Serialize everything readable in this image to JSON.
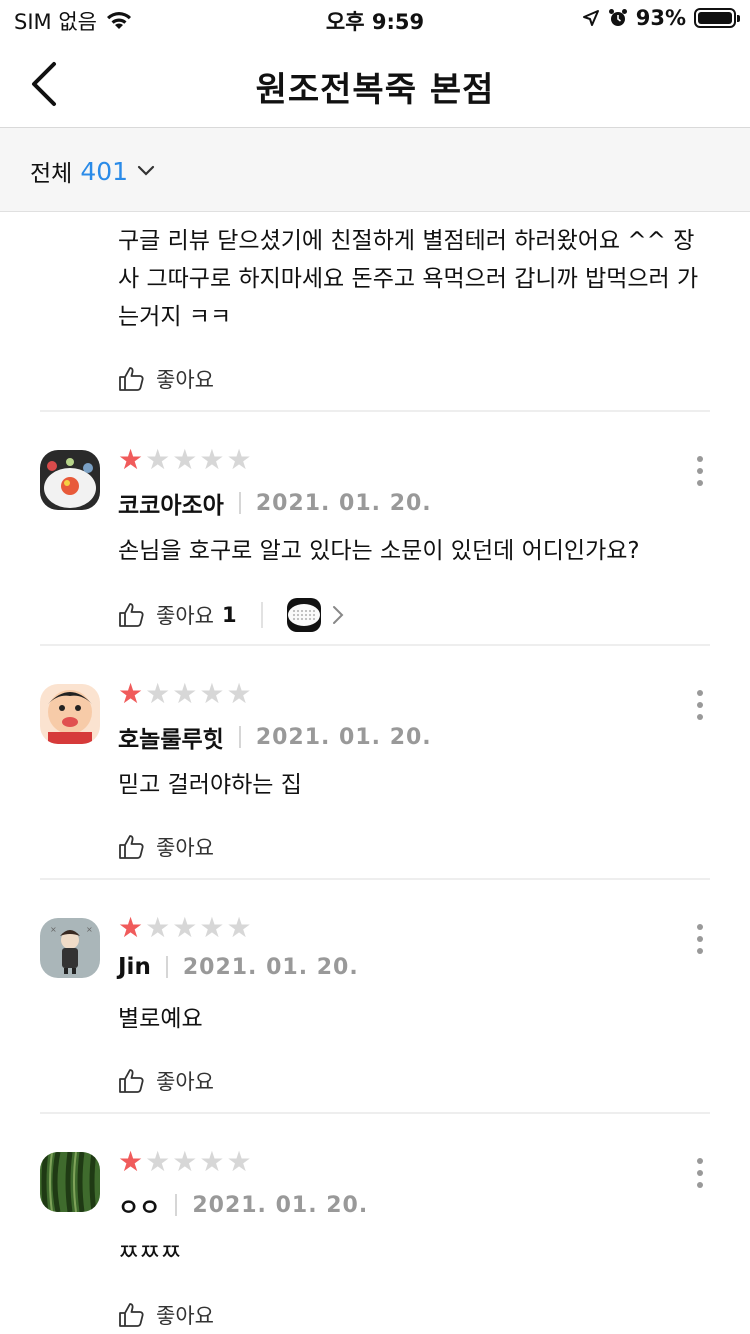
{
  "status": {
    "carrier": "SIM 없음",
    "time": "오후 9:59",
    "battery": "93%"
  },
  "header": {
    "title": "원조전복죽 본점"
  },
  "filter": {
    "label": "전체",
    "count": "401"
  },
  "partial_review": {
    "text": "구글 리뷰 닫으셨기에 친절하게 별점테러 하러왔어요 ^^ 장사 그따구로 하지마세요 돈주고 욕먹으러 갑니까 밥먹으러 가는거지 ㅋㅋ",
    "like_label": "좋아요"
  },
  "reviews": [
    {
      "name": "코코아조아",
      "date": "2021. 01. 20.",
      "rating": 1,
      "text": "손님을 호구로 알고 있다는 소문이 있던데 어디인가요?",
      "like_label": "좋아요",
      "like_count": "1"
    },
    {
      "name": "호놀룰루힛",
      "date": "2021. 01. 20.",
      "rating": 1,
      "text": "믿고 걸러야하는 집",
      "like_label": "좋아요"
    },
    {
      "name": "Jin",
      "date": "2021. 01. 20.",
      "rating": 1,
      "text": "별로예요",
      "like_label": "좋아요"
    },
    {
      "name": "ㅇㅇ",
      "date": "2021. 01. 20.",
      "rating": 1,
      "text": "ㅉㅉㅉ",
      "like_label": "좋아요"
    }
  ],
  "colors": {
    "accent": "#2a8be8",
    "star_on": "#f05b5b",
    "star_off": "#d7d7d7"
  }
}
